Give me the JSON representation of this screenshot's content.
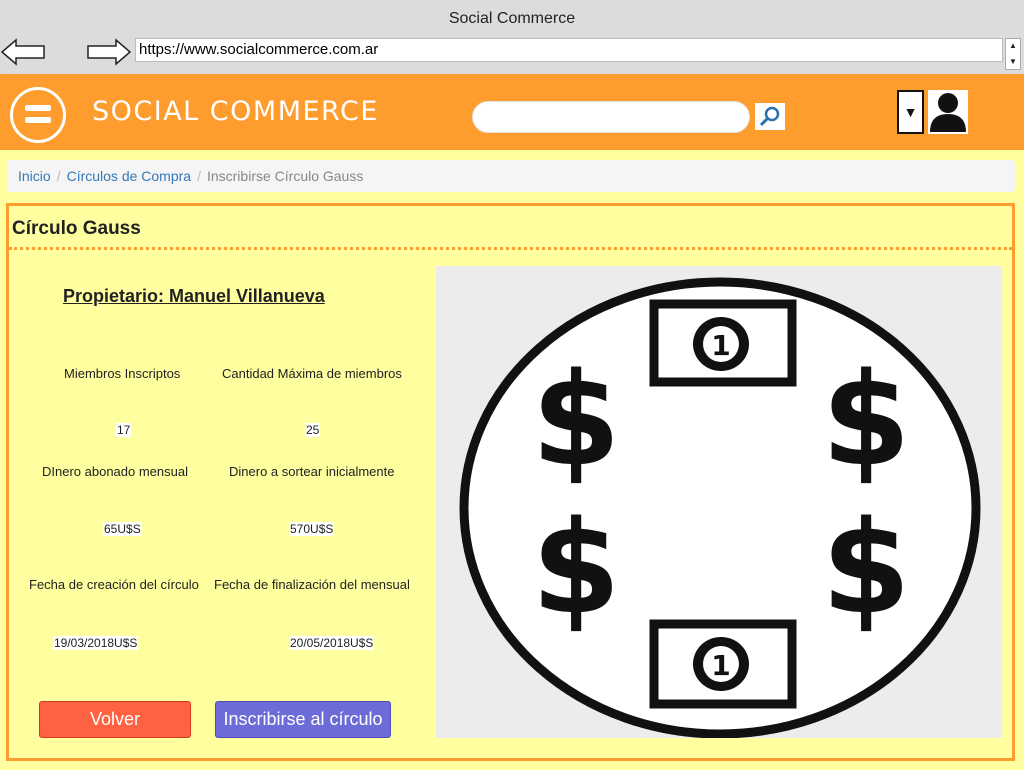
{
  "browser": {
    "title": "Social Commerce",
    "url": "https://www.socialcommerce.com.ar"
  },
  "header": {
    "brand": "SOCIAL COMMERCE",
    "search_placeholder": "",
    "icons": [
      "menu-icon",
      "search-icon",
      "dropdown-arrow-icon",
      "user-avatar-icon"
    ],
    "accent_color": "#ff9c2e"
  },
  "breadcrumb": {
    "items": [
      "Inicio",
      "Círculos de Compra"
    ],
    "active": "Inscribirse Círculo Gauss"
  },
  "panel": {
    "title": "Círculo Gauss",
    "owner": "Propietario: Manuel Villanueva",
    "stats": [
      {
        "label": "Miembros Inscriptos",
        "value": "17"
      },
      {
        "label": "Cantidad Máxima de miembros",
        "value": "25"
      },
      {
        "label": "DInero abonado mensual",
        "value": "65U$S"
      },
      {
        "label": "Dinero a sortear inicialmente",
        "value": "570U$S"
      },
      {
        "label": "Fecha de creación del círculo",
        "value": "19/03/2018U$S"
      },
      {
        "label": "Fecha de finalización del mensual",
        "value": "20/05/2018U$S"
      }
    ],
    "buttons": {
      "back": "Volver",
      "join": "Inscribirse al círculo"
    },
    "image": {
      "bill_denomination": "1",
      "symbol": "$"
    }
  }
}
